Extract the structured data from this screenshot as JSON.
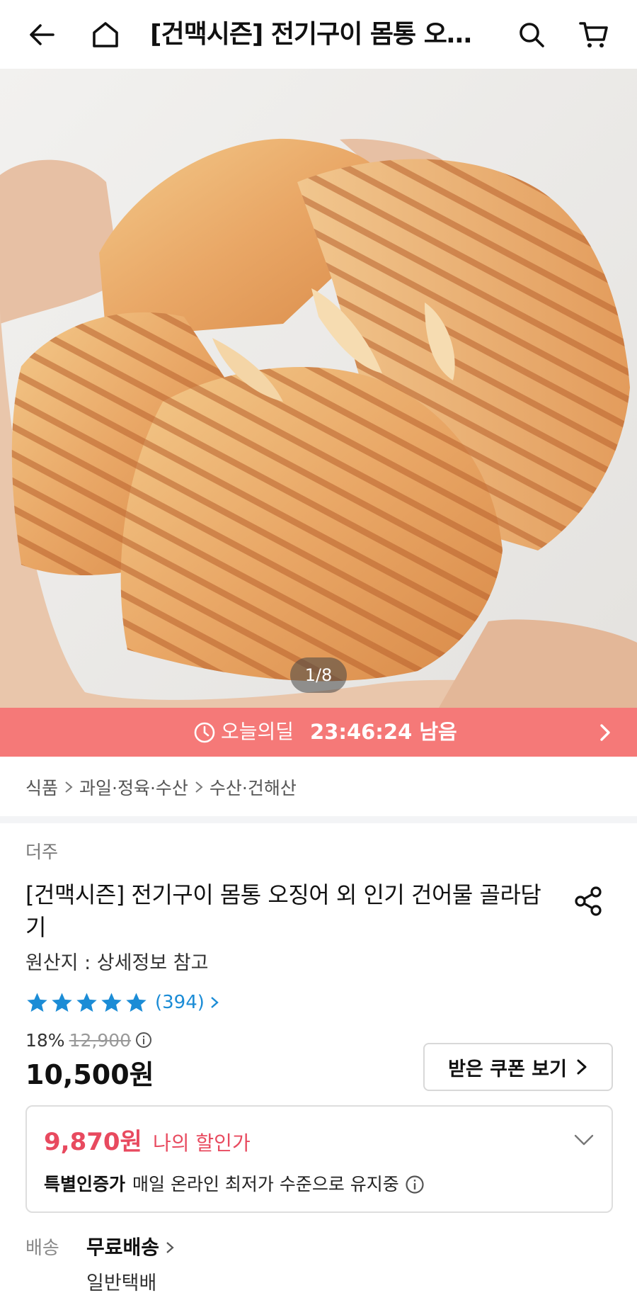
{
  "header": {
    "title": "[건맥시즌] 전기구이 몸통 오징어 외 인기 건어물 골라담기",
    "back_icon": "arrow-left-icon",
    "home_icon": "home-icon",
    "search_icon": "search-icon",
    "cart_icon": "cart-icon"
  },
  "gallery": {
    "pager": "1/8"
  },
  "deal": {
    "label": "오늘의딜",
    "time_left": "23:46:24 남음",
    "color": "#f57978"
  },
  "breadcrumb": [
    "식품",
    "과일·정육·수산",
    "수산·건해산"
  ],
  "product": {
    "brand": "더주",
    "title": "[건맥시즌] 전기구이 몸통 오징어 외 인기 건어물 골라담기",
    "origin": "원산지 : 상세정보 참고",
    "rating_stars": 5,
    "review_count": "(394)",
    "discount_rate": "18%",
    "original_price": "12,900",
    "price": "10,500원",
    "coupon_button": "받은 쿠폰 보기"
  },
  "my_price": {
    "amount": "9,870원",
    "label": "나의 할인가",
    "cert_label": "특별인증가",
    "cert_text": "매일 온라인 최저가 수준으로 유지중",
    "accent": "#e84a5f"
  },
  "shipping": {
    "label": "배송",
    "value": "무료배송",
    "type": "일반택배"
  },
  "colors": {
    "star": "#1b8cd6",
    "review": "#1b8cd6"
  }
}
